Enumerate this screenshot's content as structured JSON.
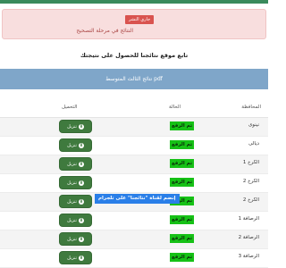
{
  "colors": {
    "accent_green": "#3f7a3e",
    "status_green": "#16c116",
    "banner_blue": "#7fa6c9",
    "alert_bg": "#f8dede",
    "telegram_blue": "#2a7fe8"
  },
  "alert": {
    "badge": "جاري النشر",
    "text": "النتائج في مرحلة التصحيح"
  },
  "follow_text": "تابع موقع نتائجنا للحصول على نتيجتك",
  "results_banner": "نتائج الثالث المتوسط pdf",
  "table": {
    "headers": {
      "governorate": "المحافظة",
      "status": "الحالة",
      "download": "التحميل"
    },
    "rows": [
      {
        "gov": "نينوى",
        "status": "تم الرفع",
        "button": "تنزيل"
      },
      {
        "gov": "ديالى",
        "status": "تم الرفع",
        "button": "تنزيل"
      },
      {
        "gov": "الكرخ 1",
        "status": "تم الرفع",
        "button": "تنزيل"
      },
      {
        "gov": "الكرخ 2",
        "status": "تم الرفع",
        "button": "تنزيل"
      },
      {
        "gov": "الكرخ 2",
        "status": "تم الرفع",
        "button": "تنزيل"
      },
      {
        "gov": "الرصافة 1",
        "status": "تم الرفع",
        "button": "تنزيل"
      },
      {
        "gov": "الرصافة 2",
        "status": "تم الرفع",
        "button": "تنزيل"
      },
      {
        "gov": "الرصافة 3",
        "status": "تم الرفع",
        "button": "تنزيل"
      }
    ]
  },
  "telegram_banner": "إنضم لقناة \"نتائجنا\" على تلجرام"
}
